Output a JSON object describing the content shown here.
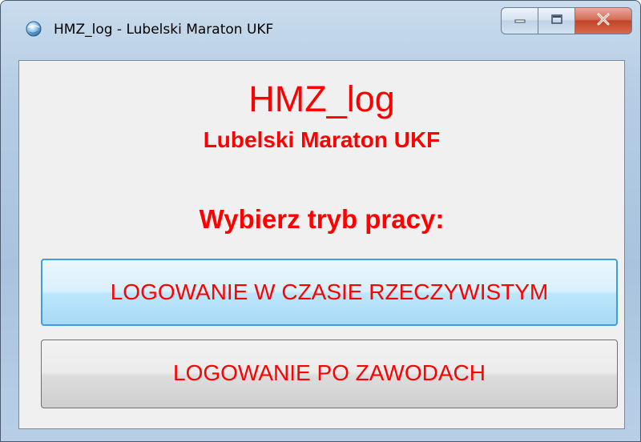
{
  "window": {
    "title": "HMZ_log - Lubelski Maraton UKF",
    "icon": "app-globe-icon",
    "controls": {
      "minimize_icon": "minimize-icon",
      "maximize_icon": "maximize-icon",
      "close_label": "X"
    }
  },
  "content": {
    "app_name": "HMZ_log",
    "event_name": "Lubelski Maraton UKF",
    "prompt": "Wybierz tryb pracy:",
    "buttons": {
      "realtime_label": "LOGOWANIE W CZASIE RZECZYWISTYM",
      "after_race_label": "LOGOWANIE PO ZAWODACH"
    }
  },
  "colors": {
    "text_accent": "#ff0000",
    "client_bg": "#f0f0f0",
    "focused_button_border": "#3c9fd8",
    "close_button": "#c2432a"
  }
}
